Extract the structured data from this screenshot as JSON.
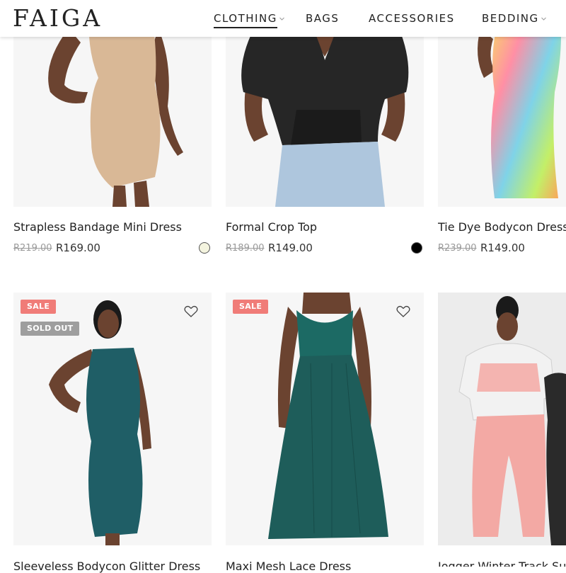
{
  "brand": "FAIGA",
  "nav": {
    "clothing": "CLOTHING",
    "bags": "BAGS",
    "accessories": "ACCESSORIES",
    "bedding": "BEDDING"
  },
  "products": [
    {
      "name": "Strapless Bandage Mini Dress",
      "old_price": "R219.00",
      "price": "R169.00",
      "swatch_color": "#f4f4df"
    },
    {
      "name": "Formal Crop Top",
      "old_price": "R189.00",
      "price": "R149.00",
      "swatch_color": "#000000"
    },
    {
      "name": "Tie Dye Bodycon Dress",
      "old_price": "R239.00",
      "price": "R149.00"
    },
    {
      "name": "Sleeveless Bodycon Glitter Dress",
      "badge_sale": "SALE",
      "badge_sold": "SOLD OUT"
    },
    {
      "name": "Maxi Mesh Lace Dress",
      "badge_sale": "SALE"
    },
    {
      "name": "Jogger Winter Track Suit"
    }
  ],
  "colors": {
    "sale_badge": "#f07c78",
    "sold_out_badge": "#9e9e9e",
    "image_bg": "#f6f6f6"
  },
  "icons": [
    "wishlist-heart-icon",
    "chevron-down-icon"
  ]
}
